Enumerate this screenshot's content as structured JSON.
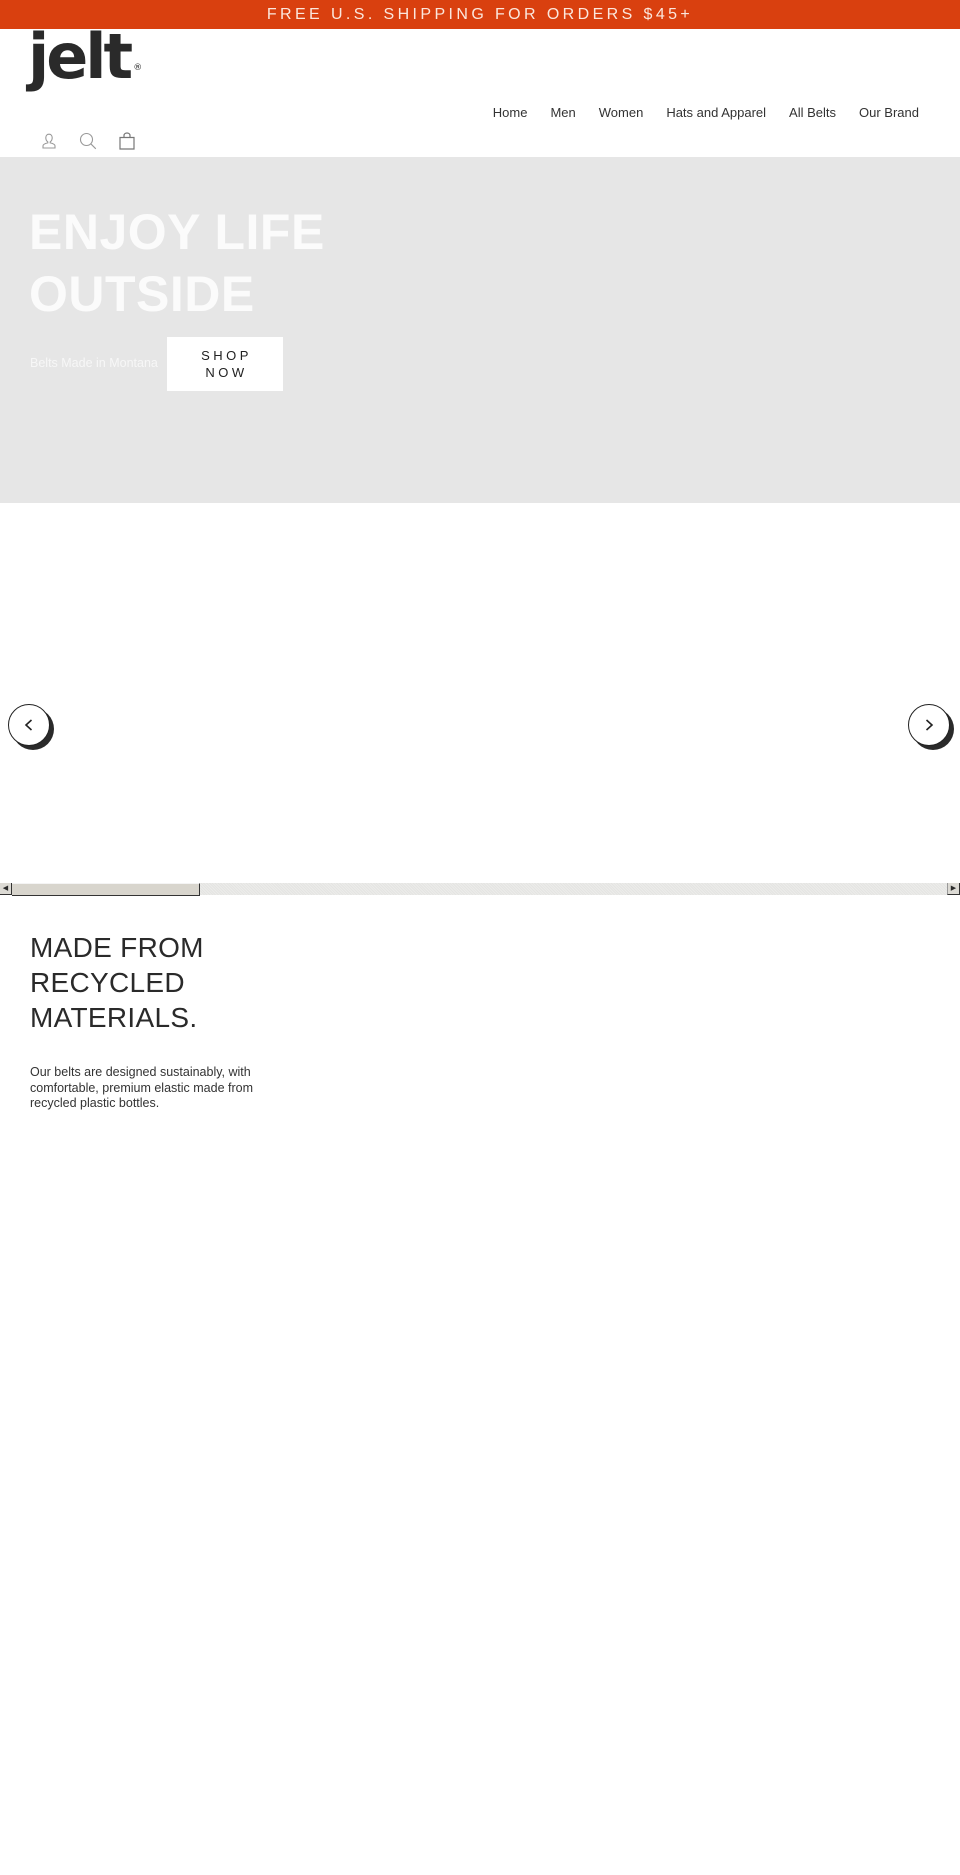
{
  "announcement": {
    "text": "FREE U.S. SHIPPING FOR ORDERS $45+"
  },
  "brand": {
    "logo_text": "jelt",
    "registered_mark": "®"
  },
  "nav": {
    "items": [
      {
        "label": "Home"
      },
      {
        "label": "Men"
      },
      {
        "label": "Women"
      },
      {
        "label": "Hats and Apparel"
      },
      {
        "label": "All Belts"
      },
      {
        "label": "Our Brand"
      }
    ]
  },
  "header_icons": [
    {
      "name": "account-icon"
    },
    {
      "name": "search-icon"
    },
    {
      "name": "cart-icon"
    }
  ],
  "hero": {
    "title_line1": "ENJOY LIFE",
    "title_line2": "OUTSIDE",
    "subtitle": "Belts Made in Montana",
    "cta_line1": "SHOP",
    "cta_line2": "NOW"
  },
  "carousel": {
    "prev_icon": "chevron-left-icon",
    "next_icon": "chevron-right-icon"
  },
  "feature": {
    "heading_lines": [
      "MADE FROM",
      "RECYCLED",
      "MATERIALS."
    ],
    "body": "Our belts are designed sustainably, with comfortable, premium elastic made from recycled plastic bottles."
  },
  "colors": {
    "announcement_bg": "#d9400f",
    "hero_bg": "#e6e6e6",
    "text": "#2b2b2b"
  }
}
